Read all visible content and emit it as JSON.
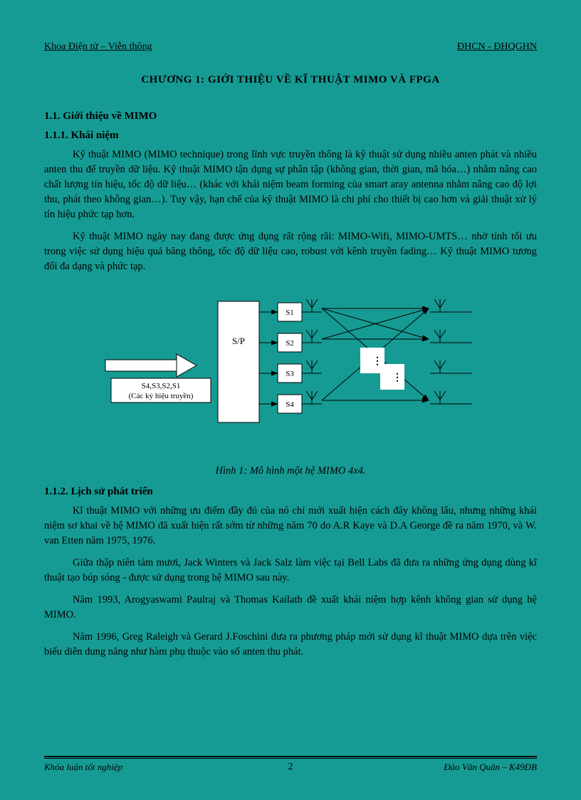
{
  "header": {
    "left": "Khoa Điện tử – Viễn thông",
    "right": "ĐHCN - ĐHQGHN"
  },
  "chapter_title": "CHƯƠNG 1: GIỚI THIỆU VỀ KĨ THUẬT MIMO VÀ FPGA",
  "sec1_1": "1.1. Giới thiệu về MIMO",
  "sec1_1_1": "1.1.1. Khái niệm",
  "para1": "Kỹ thuật MIMO (MIMO technique) trong lĩnh vực truyền thông là kỹ thuật sử dụng nhiều anten phát và nhiều anten thu để truyền dữ liệu. Kỹ thuật MIMO tận dụng sự phân tập (không gian, thời gian, mã hóa…) nhằm nâng cao chất lượng tín hiệu, tốc độ dữ liệu… (khác với khái niệm beam forming của smart aray antenna nhằm nâng cao độ lợi thu, phát theo không gian…). Tuy vậy, hạn chế của kỹ thuật MIMO là chi phí cho thiết bị cao hơn và giải thuật xử lý tín hiệu phức tạp hơn.",
  "para2": "Kỹ thuật MIMO ngày nay đang được ứng dụng rất rộng rãi: MIMO-Wifi, MIMO-UMTS… nhờ tính tối ưu trong việc sử dụng hiệu quả băng thông, tốc độ dữ liệu cao, robust với kênh truyền fading… Kỹ thuật MIMO tương đối đa dạng và phức tạp.",
  "figure": {
    "input_label_line1": "S4,S3,S2,S1",
    "input_label_line2": "(Các ký hiệu truyền)",
    "sp_label": "S/P",
    "s": [
      "S1",
      "S2",
      "S3",
      "S4"
    ]
  },
  "figure_caption": "Hình 1: Mô hình một hệ MIMO 4x4.",
  "sec1_1_2": "1.1.2. Lịch sử phát triển",
  "para3": "Kĩ thuật MIMO với những ưu điểm đầy đủ của nó chỉ mới xuất hiện cách đây không lâu, nhưng những khái niệm sơ khai về hệ MIMO đã xuất hiện rất sớm từ những năm 70 do A.R Kaye và D.A George đề ra năm 1970, và W. van Etten năm 1975, 1976.",
  "para4": "Giữa thập niên tám mươi, Jack Winters và Jack Salz làm việc tại Bell Labs đã đưa ra những ứng dụng dùng kĩ thuật tạo búp sóng - được sử dụng trong hệ MIMO sau này.",
  "para5": "Năm 1993, Arogyaswami Paulraj và Thomas Kailath đề xuất khái niệm hợp kênh không gian sử dụng hệ MIMO.",
  "para6": "Năm 1996, Greg Raleigh và Gerard J.Foschini đưa ra phương pháp mới sử dụng kĩ thuật MIMO dựa trên việc biểu diễn dung năng như hàm phụ thuộc vào số anten thu phát.",
  "footer": {
    "left": "Khóa luận tốt nghiệp",
    "right": "Đào Văn Quân – K49ĐB",
    "page": "2"
  }
}
